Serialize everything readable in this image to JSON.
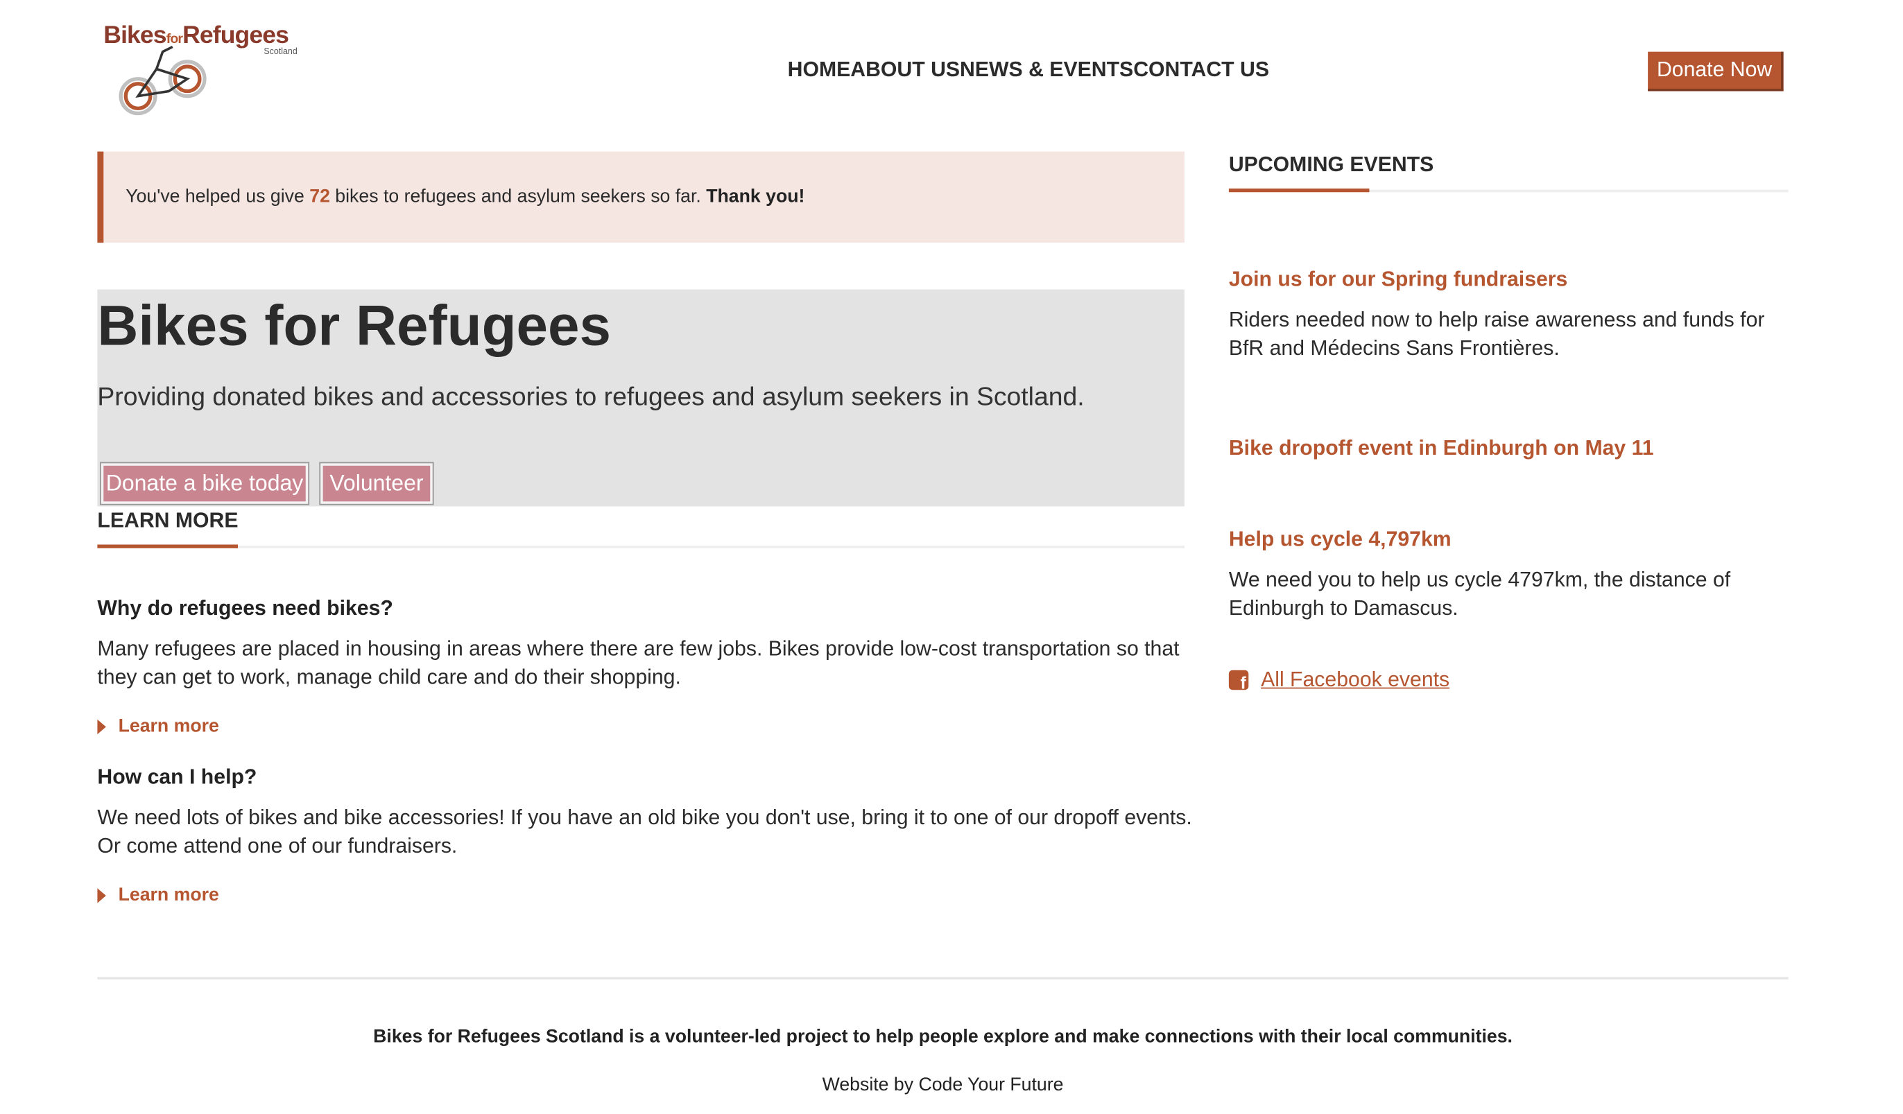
{
  "header": {
    "logo_brand_bikes": "Bikes",
    "logo_brand_for": "for",
    "logo_brand_refugees": "Refugees",
    "logo_sub": "Scotland",
    "nav": [
      "HOME",
      "ABOUT US",
      "NEWS & EVENTS",
      "CONTACT US"
    ],
    "donate_now": "Donate Now"
  },
  "callout": {
    "prefix": "You've helped us give ",
    "count": "72",
    "middle": " bikes to refugees and asylum seekers so far. ",
    "thanks": "Thank you!"
  },
  "hero": {
    "title": "Bikes for Refugees",
    "subtitle": "Providing donated bikes and accessories to refugees and asylum seekers in Scotland.",
    "donate_bike_button": "Donate a bike today",
    "volunteer_button": "Volunteer"
  },
  "learn_more_section": {
    "heading": "LEARN MORE",
    "items": [
      {
        "question": "Why do refugees need bikes?",
        "answer": "Many refugees are placed in housing in areas where there are few jobs. Bikes provide low-cost transportation so that they can get to work, manage child care and do their shopping.",
        "link": "Learn more"
      },
      {
        "question": "How can I help?",
        "answer": "We need lots of bikes and bike accessories! If you have an old bike you don't use, bring it to one of our dropoff events. Or come attend one of our fundraisers.",
        "link": "Learn more"
      }
    ]
  },
  "events": {
    "heading": "UPCOMING EVENTS",
    "items": [
      {
        "title": "Join us for our Spring fundraisers",
        "description": "Riders needed now to help raise awareness and funds for BfR and Médecins Sans Frontières."
      },
      {
        "title": "Bike dropoff event in Edinburgh on May 11",
        "description": ""
      },
      {
        "title": "Help us cycle 4,797km",
        "description": "We need you to help us cycle 4797km, the distance of Edinburgh to Damascus."
      }
    ],
    "facebook_link": "All Facebook events"
  },
  "footer": {
    "main": "Bikes for Refugees Scotland is a volunteer-led project to help people explore and make connections with their local communities.",
    "credit": "Website by Code Your Future"
  },
  "colors": {
    "accent": "#b55630",
    "callout_bg": "#f5e6e2",
    "hero_bg": "#e3e3e3",
    "pink_button": "#c98590"
  }
}
